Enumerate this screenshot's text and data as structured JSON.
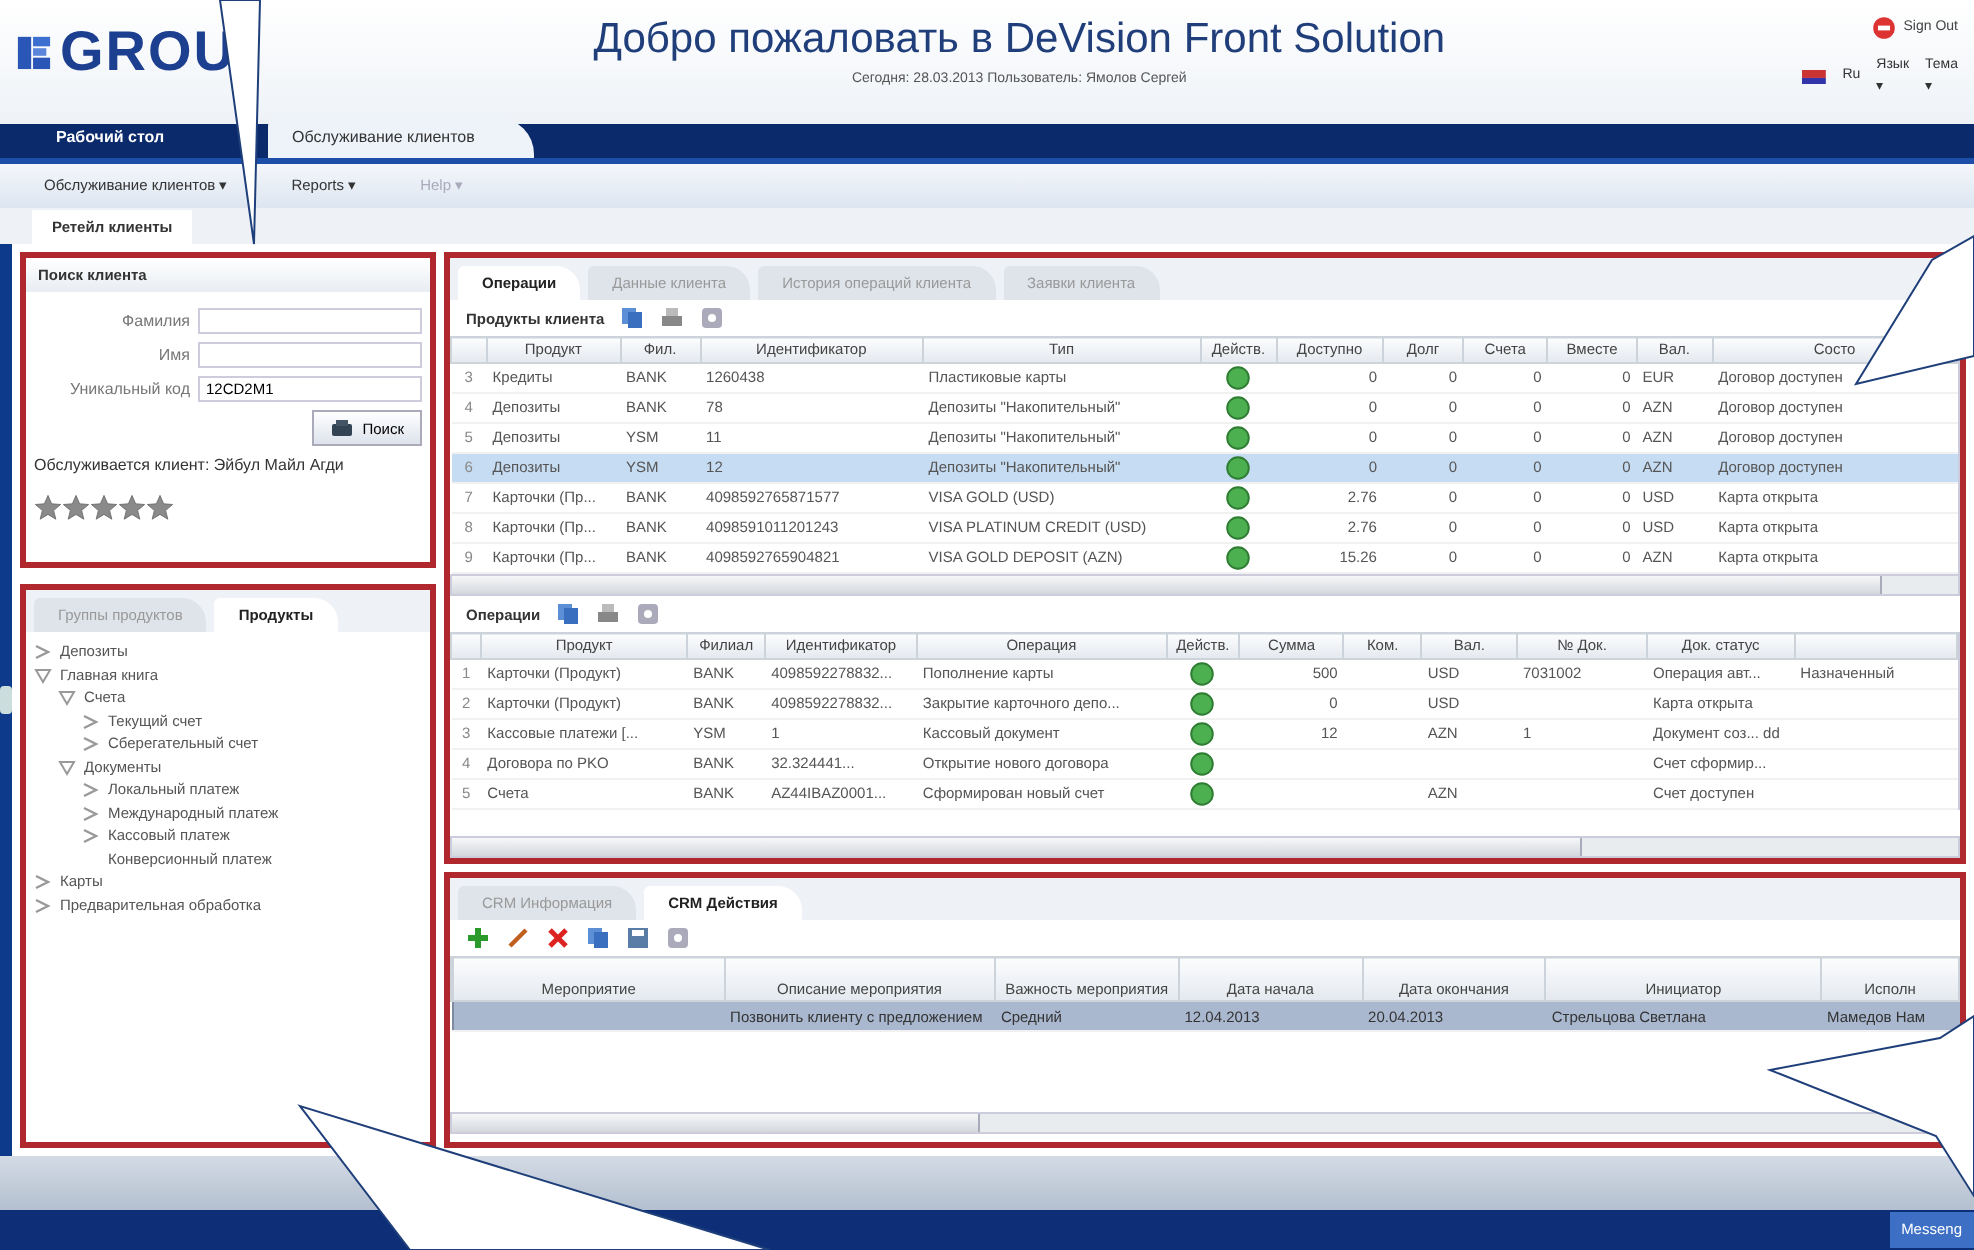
{
  "header": {
    "logo": "GROU",
    "title": "Добро пожаловать в DeVision Front Solution",
    "subtitle": "Сегодня: 28.03.2013   Пользователь: Ямолов Сергей",
    "sign_out": "Sign Out",
    "language": "Ru",
    "menus": [
      "Язык ▾",
      "Тема ▾"
    ]
  },
  "main_tabs": [
    {
      "label": "Рабочий стол",
      "selected": false
    },
    {
      "label": "Обслуживание клиентов",
      "selected": true
    }
  ],
  "menu": [
    {
      "label": "Обслуживание клиентов ▾",
      "disabled": false
    },
    {
      "label": "Reports ▾",
      "disabled": false
    },
    {
      "label": "Help ▾",
      "disabled": true
    }
  ],
  "section_title": "Ретейл клиенты",
  "search": {
    "title": "Поиск клиента",
    "fields": [
      {
        "label": "Фамилия"
      },
      {
        "label": "Имя"
      },
      {
        "label": "Уникальный код",
        "value": "12CD2M1"
      }
    ],
    "button": "Поиск",
    "served_client": "Обслуживается клиент: Эйбул Майл Агди",
    "stars": 5
  },
  "products": {
    "tabs": [
      {
        "label": "Группы продуктов",
        "selected": false
      },
      {
        "label": "Продукты",
        "selected": true
      }
    ],
    "tree": [
      {
        "label": "Депозиты",
        "expanded": false
      },
      {
        "label": "Главная книга",
        "expanded": true,
        "children": [
          {
            "label": "Счета",
            "expanded": true,
            "children": [
              {
                "label": "Текущий счет",
                "expanded": false
              },
              {
                "label": "Сберегательный счет",
                "expanded": false
              }
            ]
          },
          {
            "label": "Документы",
            "expanded": true,
            "children": [
              {
                "label": "Локальный платеж",
                "expanded": false
              },
              {
                "label": "Международный платеж",
                "expanded": false
              },
              {
                "label": "Кассовый платеж",
                "expanded": false
              },
              {
                "label": "Конверсионный платеж"
              }
            ]
          }
        ]
      },
      {
        "label": "Карты",
        "expanded": false
      },
      {
        "label": "Предварительная обработка",
        "expanded": false
      }
    ]
  },
  "client_panel": {
    "tabs": [
      {
        "label": "Операции",
        "selected": true
      },
      {
        "label": "Данные клиента",
        "selected": false
      },
      {
        "label": "История операций клиента",
        "selected": false
      },
      {
        "label": "Заявки клиента",
        "selected": false
      }
    ],
    "products_table": {
      "title": "Продукты клиента",
      "columns": [
        {
          "kind": "index"
        },
        {
          "label": "Продукт",
          "kind": "text"
        },
        {
          "label": "Фил.",
          "kind": "text"
        },
        {
          "label": "Идентификатор",
          "kind": "text"
        },
        {
          "label": "Тип",
          "kind": "text"
        },
        {
          "label": "Действ.",
          "kind": "status"
        },
        {
          "label": "Доступно",
          "kind": "num"
        },
        {
          "label": "Долг",
          "kind": "num"
        },
        {
          "label": "Счета",
          "kind": "num"
        },
        {
          "label": "Вместе",
          "kind": "num"
        },
        {
          "label": "Вал.",
          "kind": "text"
        },
        {
          "label": "Состо",
          "kind": "text"
        }
      ],
      "rows": [
        {
          "cells": [
            "3",
            "Кредиты",
            "BANK",
            "1260438",
            "Пластиковые карты",
            null,
            "0",
            "0",
            "0",
            "0",
            "EUR",
            "Договор доступен"
          ],
          "selected": false
        },
        {
          "cells": [
            "4",
            "Депозиты",
            "BANK",
            "78",
            "Депозиты \"Накопительный\"",
            null,
            "0",
            "0",
            "0",
            "0",
            "AZN",
            "Договор доступен"
          ],
          "selected": false
        },
        {
          "cells": [
            "5",
            "Депозиты",
            "YSM",
            "11",
            "Депозиты \"Накопительный\"",
            null,
            "0",
            "0",
            "0",
            "0",
            "AZN",
            "Договор доступен"
          ],
          "selected": false
        },
        {
          "cells": [
            "6",
            "Депозиты",
            "YSM",
            "12",
            "Депозиты \"Накопительный\"",
            null,
            "0",
            "0",
            "0",
            "0",
            "AZN",
            "Договор доступен"
          ],
          "selected": true
        },
        {
          "cells": [
            "7",
            "Карточки (Пр...",
            "BANK",
            "4098592765871577",
            "VISA GOLD (USD)",
            null,
            "2.76",
            "0",
            "0",
            "0",
            "USD",
            "Карта открыта"
          ],
          "selected": false
        },
        {
          "cells": [
            "8",
            "Карточки (Пр...",
            "BANK",
            "4098591011201243",
            "VISA PLATINUM CREDIT (USD)",
            null,
            "2.76",
            "0",
            "0",
            "0",
            "USD",
            "Карта открыта"
          ],
          "selected": false
        },
        {
          "cells": [
            "9",
            "Карточки (Пр...",
            "BANK",
            "4098592765904821",
            "VISA GOLD DEPOSIT (AZN)",
            null,
            "15.26",
            "0",
            "0",
            "0",
            "AZN",
            "Карта открыта"
          ],
          "selected": false
        }
      ]
    },
    "operations_table": {
      "title": "Операции",
      "columns": [
        {
          "kind": "index"
        },
        {
          "label": "Продукт",
          "kind": "text"
        },
        {
          "label": "Филиал",
          "kind": "text"
        },
        {
          "label": "Идентификатор",
          "kind": "text"
        },
        {
          "label": "Операция",
          "kind": "text"
        },
        {
          "label": "Действ.",
          "kind": "status"
        },
        {
          "label": "Сумма",
          "kind": "num"
        },
        {
          "label": "Ком.",
          "kind": "num"
        },
        {
          "label": "Вал.",
          "kind": "text"
        },
        {
          "label": "№ Док.",
          "kind": "text"
        },
        {
          "label": "Док. статус",
          "kind": "text"
        },
        {
          "kind": "text"
        }
      ],
      "rows": [
        {
          "cells": [
            "1",
            "Карточки (Продукт)",
            "BANK",
            "4098592278832...",
            "Пополнение карты",
            null,
            "500",
            null,
            "USD",
            "7031002",
            "Операция авт...",
            "Назначенный"
          ],
          "selected": false
        },
        {
          "cells": [
            "2",
            "Карточки (Продукт)",
            "BANK",
            "4098592278832...",
            "Закрытие карточного депо...",
            null,
            "0",
            null,
            "USD",
            null,
            "Карта открыта",
            null
          ],
          "selected": false
        },
        {
          "cells": [
            "3",
            "Кассовые платежи [...",
            "YSM",
            "1",
            "Кассовый документ",
            null,
            "12",
            null,
            "AZN",
            "1",
            "Документ соз...  dd",
            null
          ],
          "selected": false
        },
        {
          "cells": [
            "4",
            "Договора по PKO",
            "BANK",
            "32.324441...",
            "Открытие нового договора",
            null,
            null,
            null,
            null,
            null,
            "Счет сформир...",
            null
          ],
          "selected": false
        },
        {
          "cells": [
            "5",
            "Счета",
            "BANK",
            "AZ44IBAZ0001...",
            "Сформирован новый счет",
            null,
            null,
            null,
            "AZN",
            null,
            "Счет доступен",
            null
          ],
          "selected": false
        }
      ]
    }
  },
  "crm": {
    "tabs": [
      {
        "label": "CRM Информация",
        "selected": false
      },
      {
        "label": "CRM Действия",
        "selected": true
      }
    ],
    "columns": [
      {
        "kind": "index"
      },
      {
        "label": "Мероприятие",
        "kind": "text"
      },
      {
        "label": "Описание мероприятия",
        "kind": "text"
      },
      {
        "label": "Важность мероприятия",
        "kind": "text"
      },
      {
        "label": "Дата начала",
        "kind": "text"
      },
      {
        "label": "Дата окончания",
        "kind": "text"
      },
      {
        "label": "Инициатор",
        "kind": "text"
      },
      {
        "label": "Исполн",
        "kind": "text"
      }
    ],
    "rows": [
      {
        "cells": [
          null,
          null,
          "Позвонить клиенту с предложением",
          "Средний",
          "12.04.2013",
          "20.04.2013",
          "Стрельцова Светлана",
          "Мамедов Нам"
        ],
        "selected": true
      }
    ]
  },
  "taskbar": {
    "messenger": "Messeng"
  }
}
